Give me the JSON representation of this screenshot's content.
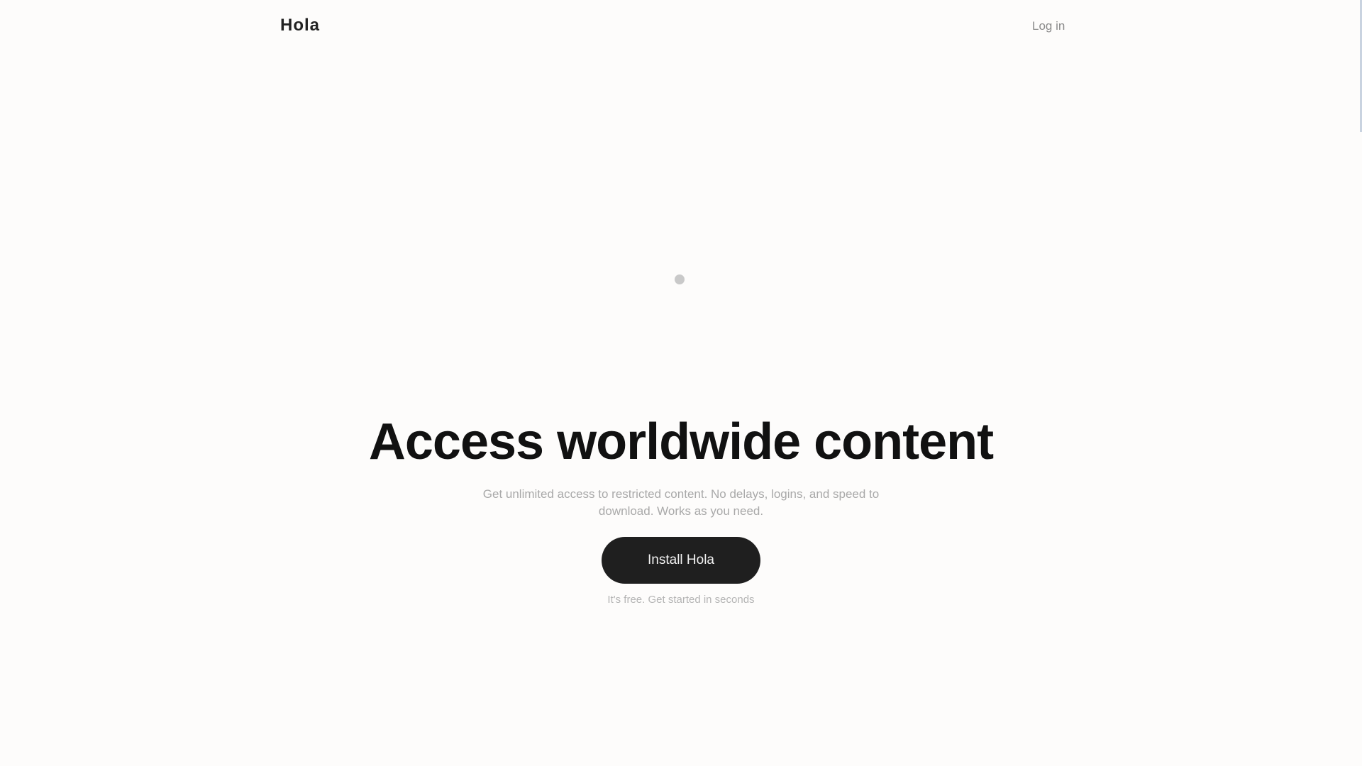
{
  "header": {
    "logo_text": "Hola",
    "nav_link": "Log in"
  },
  "hero": {
    "title": "Access worldwide content",
    "subtitle": "Get unlimited access to restricted content. No delays, logins, and speed to download. Works as you need.",
    "cta_label": "Install Hola",
    "footnote": "It's free. Get started in seconds"
  },
  "colors": {
    "background": "#fdfcfb",
    "text": "#111111",
    "button": "#1f1f1f"
  }
}
